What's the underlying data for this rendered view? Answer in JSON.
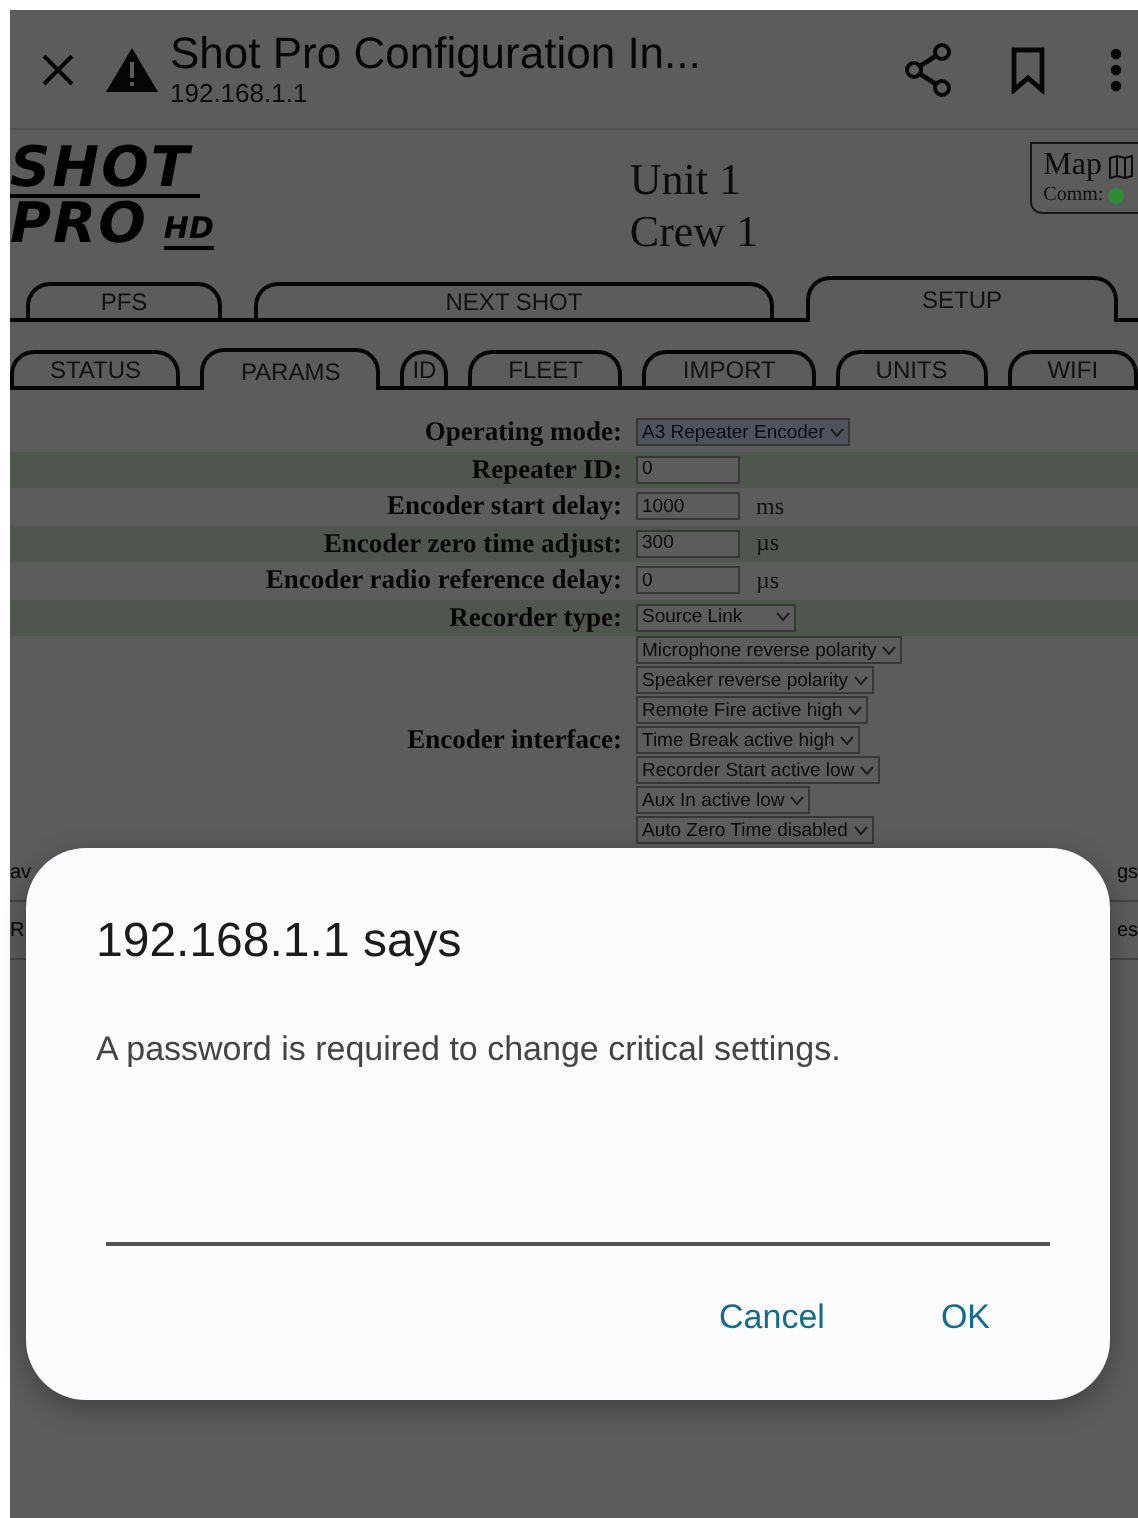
{
  "browser_bar": {
    "title": "Shot Pro Configuration In...",
    "url": "192.168.1.1"
  },
  "header": {
    "logo": {
      "line1": "SHOT",
      "line2": "PRO",
      "badge": "HD"
    },
    "unit": "Unit 1",
    "crew": "Crew 1",
    "map_button": {
      "label": "Map"
    },
    "comm": {
      "label": "Comm:",
      "color": "#2f8a36"
    }
  },
  "main_tabs": [
    {
      "label": "PFS",
      "selected": false
    },
    {
      "label": "NEXT SHOT",
      "selected": false
    },
    {
      "label": "SETUP",
      "selected": true
    }
  ],
  "sub_tabs": [
    {
      "label": "STATUS",
      "selected": false
    },
    {
      "label": "PARAMS",
      "selected": true
    },
    {
      "label": "ID",
      "selected": false
    },
    {
      "label": "FLEET",
      "selected": false
    },
    {
      "label": "IMPORT",
      "selected": false
    },
    {
      "label": "UNITS",
      "selected": false
    },
    {
      "label": "WIFI",
      "selected": false
    }
  ],
  "form_rows": [
    {
      "label": "Operating mode:",
      "kind": "select",
      "value": "A3 Repeater Encoder",
      "highlighted": false
    },
    {
      "label": "Repeater ID:",
      "kind": "input",
      "value": "0",
      "highlighted": true
    },
    {
      "label": "Encoder start delay:",
      "kind": "input",
      "value": "1000",
      "unit": "ms",
      "highlighted": false
    },
    {
      "label": "Encoder zero time adjust:",
      "kind": "input",
      "value": "300",
      "unit": "µs",
      "highlighted": true
    },
    {
      "label": "Encoder radio reference delay:",
      "kind": "input",
      "value": "0",
      "unit": "µs",
      "highlighted": false
    },
    {
      "label": "Recorder type:",
      "kind": "select",
      "value": "Source Link",
      "highlighted": true
    },
    {
      "label": "Encoder interface:",
      "kind": "select_list",
      "options": [
        "Microphone reverse polarity",
        "Speaker reverse polarity",
        "Remote Fire active high",
        "Time Break active high",
        "Recorder Start active low",
        "Aux In active low",
        "Auto Zero Time disabled"
      ],
      "highlighted": false
    }
  ],
  "partial_rows": [
    {
      "left": "av",
      "right": "gs"
    },
    {
      "left": "R",
      "right": "es"
    }
  ],
  "dialog": {
    "title": "192.168.1.1 says",
    "message": "A password is required to change critical settings.",
    "buttons": [
      "Cancel",
      "OK"
    ]
  }
}
